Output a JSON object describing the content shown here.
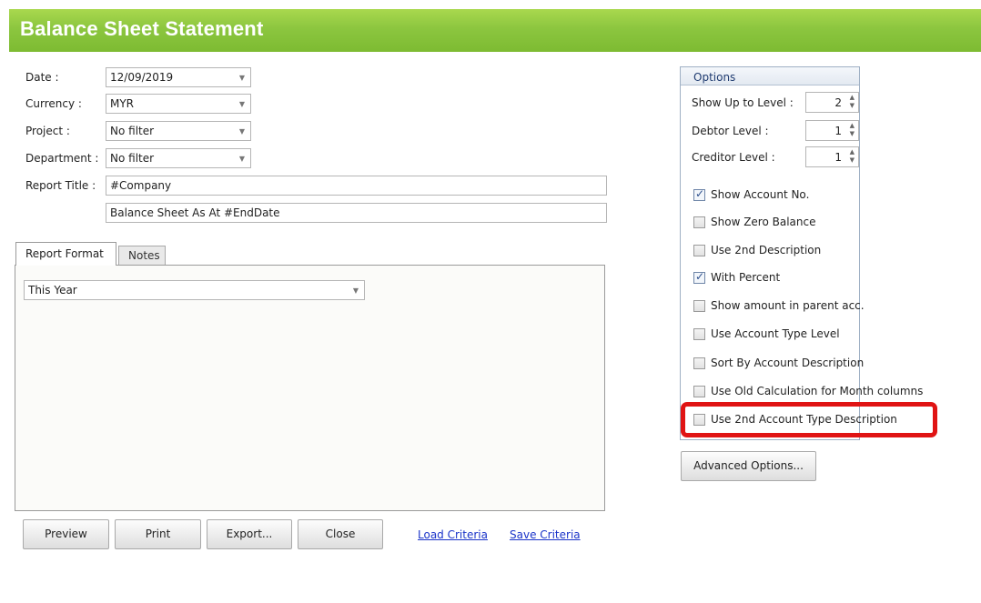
{
  "window": {
    "title": "Balance Sheet Statement"
  },
  "filters": {
    "date": {
      "label": "Date :",
      "value": "12/09/2019"
    },
    "currency": {
      "label": "Currency :",
      "value": "MYR"
    },
    "project": {
      "label": "Project :",
      "value": "No filter"
    },
    "department": {
      "label": "Department :",
      "value": "No filter"
    },
    "report_title": {
      "label": "Report Title :",
      "line1": "#Company",
      "line2": "Balance Sheet As At #EndDate"
    }
  },
  "tabs": [
    {
      "label": "Report Format",
      "active": true
    },
    {
      "label": "Notes",
      "active": false
    }
  ],
  "report_format": {
    "value": "This Year"
  },
  "buttons": {
    "preview": "Preview",
    "print": "Print",
    "export": "Export...",
    "close": "Close",
    "advanced": "Advanced Options..."
  },
  "links": {
    "load": "Load Criteria",
    "save": "Save Criteria"
  },
  "options": {
    "title": "Options",
    "levels": [
      {
        "label": "Show Up to Level :",
        "value": "2"
      },
      {
        "label": "Debtor Level :",
        "value": "1"
      },
      {
        "label": "Creditor Level :",
        "value": "1"
      }
    ],
    "checkboxes": [
      {
        "label": "Show Account No.",
        "checked": true
      },
      {
        "label": "Show Zero Balance",
        "checked": false
      },
      {
        "label": "Use 2nd Description",
        "checked": false
      },
      {
        "label": "With Percent",
        "checked": true
      },
      {
        "label": "Show amount in parent acc.",
        "checked": false
      },
      {
        "label": "Use Account Type Level",
        "checked": false
      },
      {
        "label": "Sort By Account Description",
        "checked": false
      },
      {
        "label": "Use Old Calculation for Month columns",
        "checked": false
      },
      {
        "label": "Use 2nd Account Type Description",
        "checked": false
      }
    ]
  },
  "colors": {
    "header_green": "#8cc63f",
    "link_blue": "#1a33c9",
    "highlight_red": "#e01414"
  }
}
